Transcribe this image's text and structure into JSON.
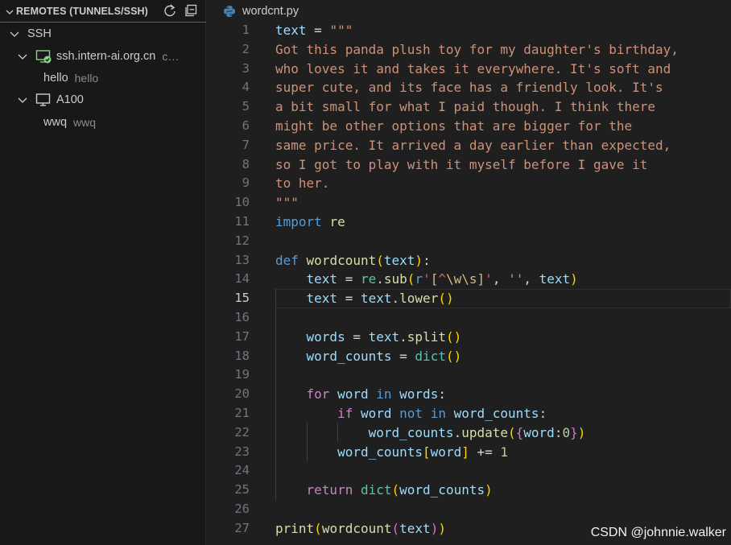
{
  "sidebar": {
    "title": "REMOTES (TUNNELS/SSH)",
    "refresh_icon": "refresh-icon",
    "collapse_all_icon": "collapse-all-icon",
    "groups": [
      {
        "label": "SSH"
      },
      {
        "label": "ssh.intern-ai.org.cn",
        "desc": "c…",
        "icon": "remote-connected-icon"
      },
      {
        "label": "hello",
        "desc": "hello"
      },
      {
        "label": "A100",
        "icon": "monitor-icon"
      },
      {
        "label": "wwq",
        "desc": "wwq"
      }
    ]
  },
  "tab": {
    "label": "wordcnt.py",
    "icon": "python-icon"
  },
  "editor": {
    "active_line": 15,
    "line_numbers": [
      "1",
      "2",
      "3",
      "4",
      "5",
      "6",
      "7",
      "8",
      "9",
      "10",
      "11",
      "12",
      "13",
      "14",
      "15",
      "16",
      "17",
      "18",
      "19",
      "20",
      "21",
      "22",
      "23",
      "24",
      "25",
      "26",
      "27"
    ],
    "lines": [
      "text = \"\"\"",
      "Got this panda plush toy for my daughter's birthday,",
      "who loves it and takes it everywhere. It's soft and",
      "super cute, and its face has a friendly look. It's",
      "a bit small for what I paid though. I think there",
      "might be other options that are bigger for the",
      "same price. It arrived a day earlier than expected,",
      "so I got to play with it myself before I gave it",
      "to her.",
      "\"\"\"",
      "import re",
      "",
      "def wordcount(text):",
      "    text = re.sub(r'[^\\w\\s]', '', text)",
      "    text = text.lower()",
      "",
      "    words = text.split()",
      "    word_counts = dict()",
      "",
      "    for word in words:",
      "        if word not in word_counts:",
      "            word_counts.update({word:0})",
      "        word_counts[word] += 1",
      "",
      "    return dict(word_counts)",
      "",
      "print(wordcount(text))"
    ]
  },
  "watermark": "CSDN @johnnie.walker",
  "colors": {
    "accent": "#0078d4",
    "string": "#ce9178",
    "keyword": "#569cd6",
    "control": "#c586c0",
    "function": "#dcdcaa",
    "variable": "#9cdcfe",
    "number": "#b5cea8",
    "type": "#4ec9b0",
    "connected": "#89d185"
  }
}
